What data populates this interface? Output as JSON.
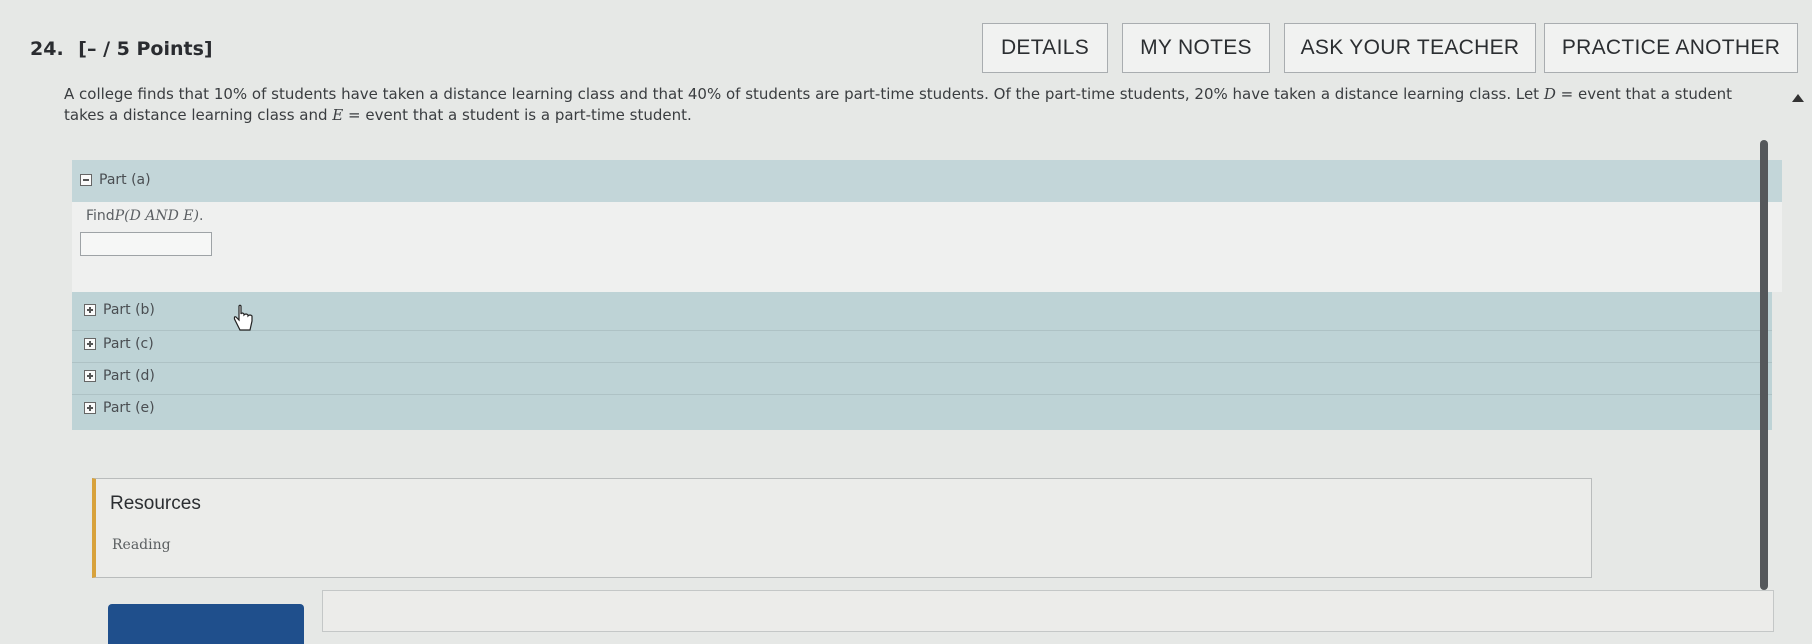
{
  "question": {
    "number": "24.",
    "points": "[– / 5 Points]",
    "text_parts": [
      "A college finds that 10% of students have taken a distance learning class and that 40% of students are part-time students. Of the part-time students, 20% have taken a distance learning class. Let ",
      "D",
      " = event that a student takes a distance learning class and ",
      "E",
      " = event that a student is a part-time student."
    ]
  },
  "toolbar": {
    "details": "DETAILS",
    "my_notes": "MY NOTES",
    "ask_teacher": "ASK YOUR TEACHER",
    "practice_another": "PRACTICE ANOTHER"
  },
  "parts": {
    "a": {
      "label": "Part (a)",
      "prompt_prefix": "Find ",
      "prompt_expr": "P(D AND E)",
      "prompt_suffix": ".",
      "answer_value": ""
    },
    "b": {
      "label": "Part (b)"
    },
    "c": {
      "label": "Part (c)"
    },
    "d": {
      "label": "Part (d)"
    },
    "e": {
      "label": "Part (e)"
    }
  },
  "resources": {
    "title": "Resources",
    "link": "Reading"
  }
}
